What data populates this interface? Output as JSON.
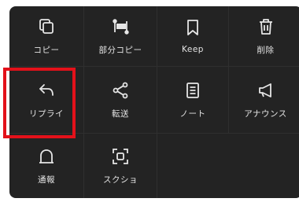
{
  "menu": {
    "items": [
      {
        "label": "コピー",
        "icon": "copy-icon"
      },
      {
        "label": "部分コピー",
        "icon": "partial-copy-icon"
      },
      {
        "label": "Keep",
        "icon": "bookmark-icon"
      },
      {
        "label": "削除",
        "icon": "trash-icon"
      },
      {
        "label": "リプライ",
        "icon": "reply-icon"
      },
      {
        "label": "転送",
        "icon": "share-icon"
      },
      {
        "label": "ノート",
        "icon": "note-icon"
      },
      {
        "label": "アナウンス",
        "icon": "megaphone-icon"
      },
      {
        "label": "通報",
        "icon": "alert-icon"
      },
      {
        "label": "スクショ",
        "icon": "screenshot-icon"
      }
    ]
  },
  "colors": {
    "menu_background": "#232323",
    "text": "#e4e4e4",
    "highlight_border": "#e3111a"
  }
}
